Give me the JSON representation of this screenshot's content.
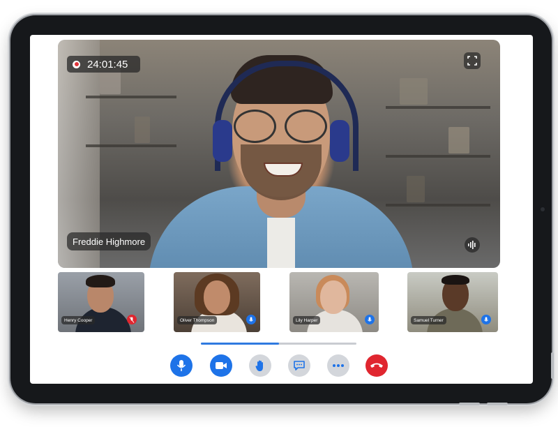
{
  "call": {
    "recording_time": "24:01:45",
    "main_speaker": "Freddie Highmore",
    "progress_fraction": 0.5
  },
  "participants": [
    {
      "name": "Henry Cooper",
      "mic": "muted"
    },
    {
      "name": "Oliver Thompson",
      "mic": "on"
    },
    {
      "name": "Lily Harper",
      "mic": "on"
    },
    {
      "name": "Samuel Turner",
      "mic": "on"
    }
  ],
  "controls": [
    {
      "id": "microphone",
      "icon": "mic-icon",
      "active": true
    },
    {
      "id": "camera",
      "icon": "video-camera-icon",
      "active": true
    },
    {
      "id": "raise-hand",
      "icon": "hand-icon",
      "active": false
    },
    {
      "id": "chat",
      "icon": "chat-bubble-icon",
      "active": false
    },
    {
      "id": "more",
      "icon": "more-dots-icon",
      "active": false
    },
    {
      "id": "end-call",
      "icon": "phone-hangup-icon",
      "active": true
    }
  ],
  "colors": {
    "accent": "#1e73e8",
    "end_call": "#e0262f",
    "inactive": "#d3d6db",
    "muted": "#e0262f"
  }
}
